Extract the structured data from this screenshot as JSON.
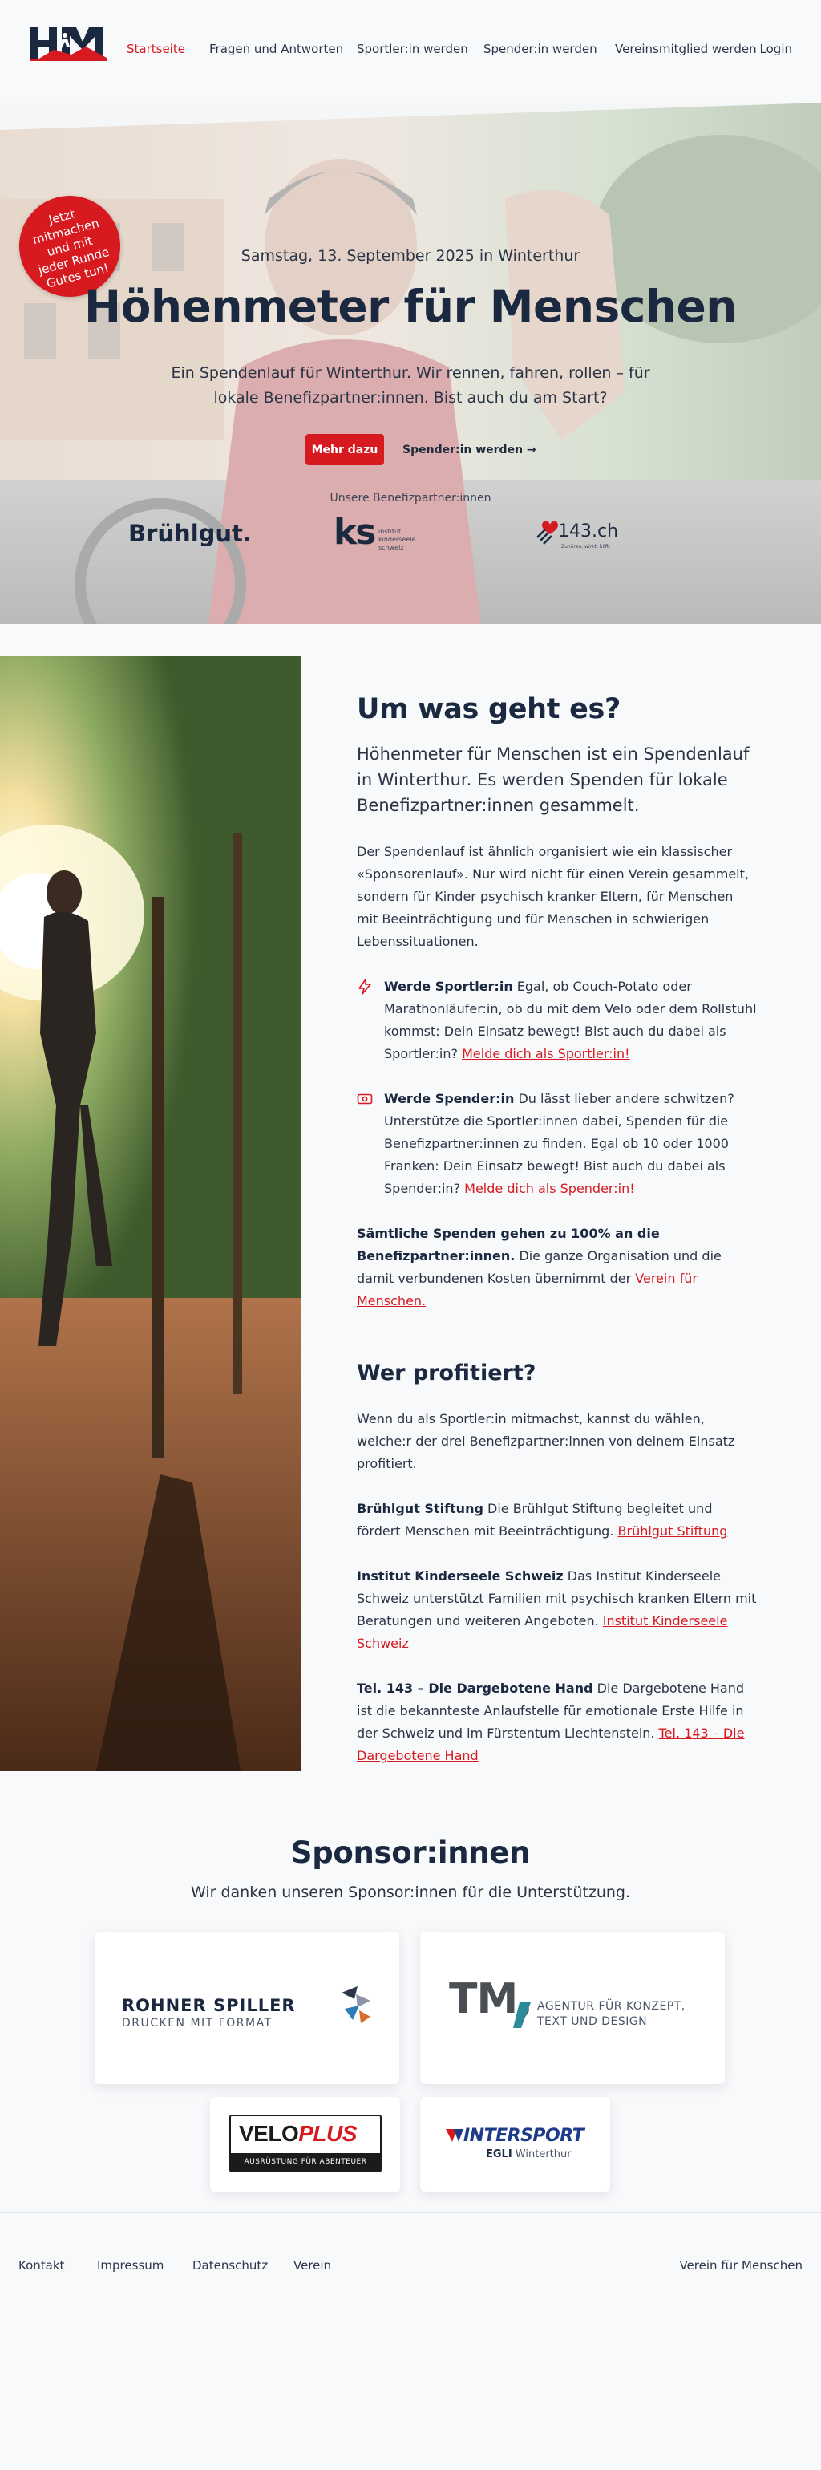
{
  "nav": {
    "logo_alt": "HfM",
    "items": [
      {
        "label": "Startseite",
        "active": true
      },
      {
        "label": "Fragen und Antworten"
      },
      {
        "label": "Sportler:in werden"
      },
      {
        "label": "Spender:in werden"
      },
      {
        "label": "Vereinsmitglied werden"
      }
    ],
    "login": "Login"
  },
  "hero": {
    "sticker": "Jetzt mitmachen und mit jeder Runde Gutes tun!",
    "date": "Samstag, 13. September 2025 in Winterthur",
    "title": "Höhenmeter für Menschen",
    "subtitle": "Ein Spendenlauf für Winterthur. Wir rennen, fahren, rollen – für lokale Benefizpartner:innen. Bist auch du am Start?",
    "btn_more": "Mehr dazu",
    "btn_donor": "Spender:in werden →",
    "partners_label": "Unsere Benefizpartner:innen",
    "partner_logos": {
      "bruehlgut": "Brühlgut.",
      "ks_big": "ks",
      "ks_line1": "institut",
      "ks_line2": "kinderseele",
      "ks_line3": "schweiz",
      "tel143": "143.ch",
      "tel143_sub": "Zuhören. wirkt. hilft."
    }
  },
  "about": {
    "title": "Um was geht es?",
    "lead": "Höhenmeter für Menschen ist ein Spendenlauf in Winterthur. Es werden Spenden für lokale Benefizpartner:innen gesammelt.",
    "intro": "Der Spendenlauf ist ähnlich organisiert wie ein klassischer «Sponsorenlauf». Nur wird nicht für einen Verein gesammelt, sondern für Kinder psychisch kranker Eltern, für Menschen mit Beeinträchtigung und für Menschen in schwierigen Lebenssituationen.",
    "feature1": {
      "icon": "lightning-icon",
      "title": "Werde Sportler:in",
      "text": " Egal, ob Couch-Potato oder Marathonläufer:in, ob du mit dem Velo oder dem Rollstuhl kommst: Dein Einsatz bewegt! Bist auch du dabei als Sportler:in? ",
      "link": "Melde dich als Sportler:in!"
    },
    "feature2": {
      "icon": "money-icon",
      "title": "Werde Spender:in",
      "text": " Du lässt lieber andere schwitzen? Unterstütze die Sportler:innen dabei, Spenden für die Benefizpartner:innen zu finden. Egal ob 10 oder 1000 Franken: Dein Einsatz bewegt! Bist auch du dabei als Spender:in? ",
      "link": "Melde dich als Spender:in!"
    },
    "note_bold": "Sämtliche Spenden gehen zu 100% an die Benefizpartner:innen.",
    "note_text": " Die ganze Organisation und die damit verbundenen Kosten übernimmt der ",
    "note_link": "Verein für Menschen.",
    "benefit_title": "Wer profitiert?",
    "benefit_intro": "Wenn du als Sportler:in mitmachst, kannst du wählen, welche:r der drei Benefizpartner:innen von deinem Einsatz profitiert.",
    "partners": [
      {
        "name": "Brühlgut Stiftung",
        "text": " Die Brühlgut Stiftung begleitet und fördert Menschen mit Beeinträchtigung. ",
        "link": "Brühlgut Stiftung"
      },
      {
        "name": "Institut Kinderseele Schweiz",
        "text": " Das Institut Kinderseele Schweiz unterstützt Familien mit psychisch kranken Eltern mit Beratungen und weiteren Angeboten. ",
        "link": "Institut Kinderseele Schweiz"
      },
      {
        "name": "Tel. 143 – Die Dargebotene Hand",
        "text": " Die Dargebotene Hand ist die bekannteste Anlaufstelle für emotionale Erste Hilfe in der Schweiz und im Fürstentum Liechtenstein. ",
        "link": "Tel. 143 – Die Dargebotene Hand"
      }
    ]
  },
  "sponsors": {
    "title": "Sponsor:innen",
    "subtitle": "Wir danken unseren Sponsor:innen für die Unterstützung.",
    "rohner_line1": "ROHNER SPILLER",
    "rohner_line2": "DRUCKEN MIT FORMAT",
    "tm_big": "TM,",
    "tm_line1": "AGENTUR FÜR KONZEPT,",
    "tm_line2": "TEXT UND DESIGN",
    "velo_a": "VELO",
    "velo_b": "PLUS",
    "velo_tag": "AUSRÜSTUNG FÜR ABENTEUER",
    "intersport": "INTERSPORT",
    "egli_a": "EGLI",
    "egli_b": " Winterthur"
  },
  "footer": {
    "links": [
      "Kontakt",
      "Impressum",
      "Datenschutz",
      "Verein"
    ],
    "right": "Verein für Menschen"
  },
  "colors": {
    "accent": "#d71920",
    "navy": "#1b2940",
    "bg": "#f8f9fb"
  }
}
